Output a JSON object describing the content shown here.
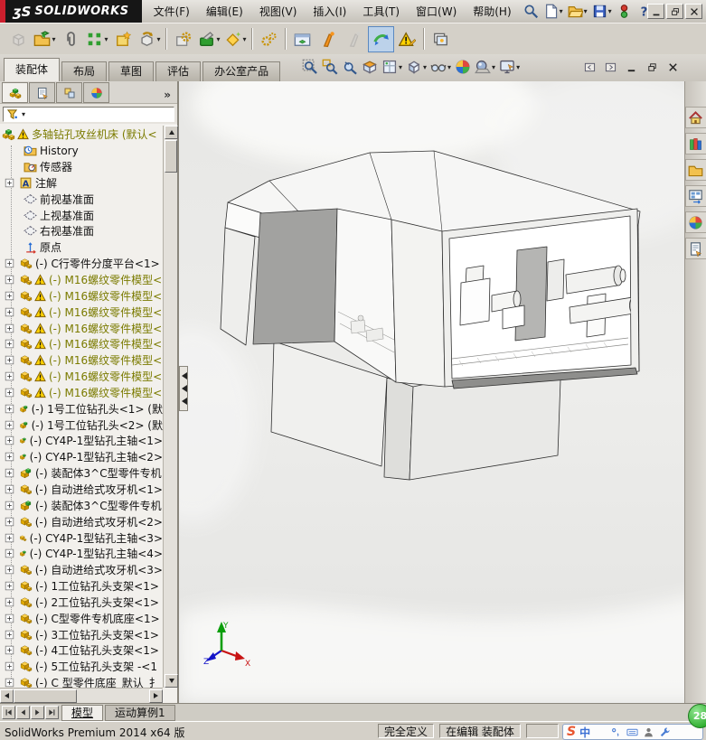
{
  "titlebar": {
    "logo_mark": "ʒS",
    "logo_text": "SOLIDWORKS",
    "menus": [
      "文件(F)",
      "编辑(E)",
      "视图(V)",
      "插入(I)",
      "工具(T)",
      "窗口(W)",
      "帮助(H)"
    ],
    "quick_buttons": [
      {
        "name": "search-button",
        "glyph": "search"
      },
      {
        "name": "new-document-button",
        "glyph": "newdoc",
        "dropdown": true
      },
      {
        "name": "open-button",
        "glyph": "open",
        "dropdown": true
      },
      {
        "name": "save-button",
        "glyph": "save",
        "dropdown": true
      },
      {
        "name": "traffic-light-button",
        "glyph": "traffic"
      },
      {
        "name": "help-button",
        "glyph": "help",
        "dropdown": true
      }
    ],
    "window_buttons": [
      {
        "name": "minimize-button",
        "glyph": "wmin"
      },
      {
        "name": "restore-button",
        "glyph": "wrest"
      },
      {
        "name": "close-button",
        "glyph": "wclose"
      }
    ]
  },
  "toolbar": {
    "buttons": [
      {
        "name": "edit-component-button",
        "glyph": "cubegray",
        "disabled": true
      },
      {
        "name": "insert-components-button",
        "glyph": "openpart",
        "dropdown": true
      },
      {
        "name": "mate-button",
        "glyph": "paperclip"
      },
      {
        "name": "linear-component-pattern-button",
        "glyph": "pattern",
        "dropdown": true
      },
      {
        "name": "smart-fasteners-button",
        "glyph": "smartfast"
      },
      {
        "name": "move-component-button",
        "glyph": "movecomp",
        "dropdown": true
      },
      {
        "sep": true
      },
      {
        "name": "assembly-features-button",
        "glyph": "gearbox"
      },
      {
        "name": "new-motion-study-button",
        "glyph": "hammergreen",
        "dropdown": true
      },
      {
        "name": "reference-geometry-button",
        "glyph": "diamondstar",
        "dropdown": true
      },
      {
        "sep": true
      },
      {
        "name": "assembly-settings-button",
        "glyph": "gears2"
      },
      {
        "sep": true
      },
      {
        "name": "show-hidden-components-button",
        "glyph": "winpart"
      },
      {
        "name": "exploded-view-button",
        "glyph": "explode"
      },
      {
        "name": "explode-line-sketch-button",
        "glyph": "explodegray",
        "disabled": true
      },
      {
        "name": "large-design-review-button",
        "glyph": "bluearrow",
        "pressed": true
      },
      {
        "name": "interference-detection-button",
        "glyph": "warnpencil"
      },
      {
        "sep": true
      },
      {
        "name": "take-snapshot-button",
        "glyph": "photos"
      }
    ]
  },
  "command_tabs": {
    "tabs": [
      {
        "label": "装配体",
        "active": true
      },
      {
        "label": "布局",
        "active": false
      },
      {
        "label": "草图",
        "active": false
      },
      {
        "label": "评估",
        "active": false
      },
      {
        "label": "办公室产品",
        "active": false
      }
    ]
  },
  "headsup": {
    "buttons": [
      {
        "name": "zoom-to-fit-button",
        "glyph": "zoomfit"
      },
      {
        "name": "zoom-to-area-button",
        "glyph": "zoomarea"
      },
      {
        "name": "magnified-selection-button",
        "glyph": "magsel"
      },
      {
        "name": "section-view-button",
        "glyph": "section"
      },
      {
        "name": "view-orientation-button",
        "glyph": "viewsheet",
        "dropdown": true
      },
      {
        "name": "display-style-button",
        "glyph": "viewcube",
        "dropdown": true
      },
      {
        "name": "hide-show-items-button",
        "glyph": "glasses",
        "dropdown": true
      },
      {
        "name": "edit-appearance-button",
        "glyph": "sphere4"
      },
      {
        "name": "apply-scene-button",
        "glyph": "scenesphere",
        "dropdown": true
      },
      {
        "name": "view-settings-button",
        "glyph": "monitor",
        "dropdown": true
      }
    ]
  },
  "doc_controls": [
    {
      "name": "doc-prev-window-button",
      "glyph": "docprev"
    },
    {
      "name": "doc-next-window-button",
      "glyph": "docnext"
    },
    {
      "name": "doc-minimize-button",
      "glyph": "wmin"
    },
    {
      "name": "doc-restore-button",
      "glyph": "wrest"
    },
    {
      "name": "doc-close-button",
      "glyph": "wclose"
    }
  ],
  "feature_panel": {
    "tabs": [
      {
        "name": "featuremanager-tab",
        "glyph": "asm",
        "active": true
      },
      {
        "name": "propertymanager-tab",
        "glyph": "propsheet",
        "active": false
      },
      {
        "name": "configurationmanager-tab",
        "glyph": "config",
        "active": false
      },
      {
        "name": "displaymanager-tab",
        "glyph": "sphere4",
        "active": false
      }
    ],
    "overflow_chevron": "»",
    "tree": {
      "items": [
        {
          "label": "多轴钻孔攻丝机床  (默认<",
          "icon": "asm",
          "warn": true,
          "olive": true,
          "root": true
        },
        {
          "label": "History",
          "icon": "history",
          "l1": true
        },
        {
          "label": "传感器",
          "icon": "sensors",
          "l1": true
        },
        {
          "label": "注解",
          "icon": "annot",
          "plus": true
        },
        {
          "label": "前视基准面",
          "icon": "plane",
          "l1": true
        },
        {
          "label": "上视基准面",
          "icon": "plane",
          "l1": true
        },
        {
          "label": "右视基准面",
          "icon": "plane",
          "l1": true
        },
        {
          "label": "原点",
          "icon": "origin",
          "l1": true
        },
        {
          "label": "(-) C行零件分度平台<1>",
          "icon": "part",
          "plus": true
        },
        {
          "label": "(-) M16螺纹零件模型<",
          "icon": "part",
          "plus": true,
          "warn": true,
          "olive": true
        },
        {
          "label": "(-) M16螺纹零件模型<",
          "icon": "part",
          "plus": true,
          "warn": true,
          "olive": true
        },
        {
          "label": "(-) M16螺纹零件模型<",
          "icon": "part",
          "plus": true,
          "warn": true,
          "olive": true
        },
        {
          "label": "(-) M16螺纹零件模型<",
          "icon": "part",
          "plus": true,
          "warn": true,
          "olive": true
        },
        {
          "label": "(-) M16螺纹零件模型<",
          "icon": "part",
          "plus": true,
          "warn": true,
          "olive": true
        },
        {
          "label": "(-) M16螺纹零件模型<",
          "icon": "part",
          "plus": true,
          "warn": true,
          "olive": true
        },
        {
          "label": "(-) M16螺纹零件模型<",
          "icon": "part",
          "plus": true,
          "warn": true,
          "olive": true
        },
        {
          "label": "(-) M16螺纹零件模型<",
          "icon": "part",
          "plus": true,
          "warn": true,
          "olive": true
        },
        {
          "label": "(-) 1号工位钻孔头<1> (默",
          "icon": "subasm",
          "plus": true
        },
        {
          "label": "(-) 1号工位钻孔头<2> (默",
          "icon": "subasm",
          "plus": true
        },
        {
          "label": "(-) CY4P-1型钻孔主轴<1>",
          "icon": "subasm",
          "plus": true
        },
        {
          "label": "(-) CY4P-1型钻孔主轴<2>",
          "icon": "subasm",
          "plus": true
        },
        {
          "label": "(-) 装配体3^C型零件专机",
          "icon": "subasm",
          "plus": true
        },
        {
          "label": "(-) 自动进给式攻牙机<1>",
          "icon": "part",
          "plus": true
        },
        {
          "label": "(-) 装配体3^C型零件专机",
          "icon": "subasm",
          "plus": true
        },
        {
          "label": "(-) 自动进给式攻牙机<2>",
          "icon": "part",
          "plus": true
        },
        {
          "label": "(-) CY4P-1型钻孔主轴<3>",
          "icon": "part",
          "plus": true
        },
        {
          "label": "(-) CY4P-1型钻孔主轴<4>",
          "icon": "subasm",
          "plus": true
        },
        {
          "label": "(-) 自动进给式攻牙机<3>",
          "icon": "part",
          "plus": true
        },
        {
          "label": "(-) 1工位钻孔头支架<1>",
          "icon": "part",
          "plus": true
        },
        {
          "label": "(-) 2工位钻孔头支架<1>",
          "icon": "part",
          "plus": true
        },
        {
          "label": "(-) C型零件专机底座<1>",
          "icon": "part",
          "plus": true
        },
        {
          "label": "(-) 3工位钻孔头支架<1>",
          "icon": "part",
          "plus": true
        },
        {
          "label": "(-) 4工位钻孔头支架<1>",
          "icon": "part",
          "plus": true
        },
        {
          "label": "(-) 5工位钻孔头支架 -<1",
          "icon": "part",
          "plus": true
        },
        {
          "label": "(-) C 型零件底座_默认_扌",
          "icon": "part",
          "plus": true
        }
      ]
    }
  },
  "task_pane": {
    "tabs": [
      {
        "name": "solidworks-resources-tab",
        "glyph": "home"
      },
      {
        "name": "design-library-tab",
        "glyph": "library"
      },
      {
        "name": "file-explorer-tab",
        "glyph": "folderx"
      },
      {
        "name": "view-palette-tab",
        "glyph": "palette"
      },
      {
        "name": "appearances-scenes-tab",
        "glyph": "sphere4"
      },
      {
        "name": "custom-properties-tab",
        "glyph": "props"
      }
    ]
  },
  "motion_bar": {
    "nav": [
      {
        "name": "first-tab-button",
        "glyph": "navfirst"
      },
      {
        "name": "prev-tab-button",
        "glyph": "navprev"
      },
      {
        "name": "next-tab-button",
        "glyph": "navnext"
      },
      {
        "name": "last-tab-button",
        "glyph": "navlast"
      }
    ],
    "tabs": [
      {
        "label": "模型",
        "active": true
      },
      {
        "label": "运动算例1",
        "active": false
      }
    ]
  },
  "status_bar": {
    "app_version": "SolidWorks Premium 2014 x64 版",
    "define_state": "完全定义",
    "edit_state": "在编辑  装配体"
  },
  "ime_bar": {
    "logo": "S",
    "lang": "中",
    "icons": [
      {
        "name": "ime-mode-icon",
        "glyph": "moon"
      },
      {
        "name": "ime-punctuation-icon",
        "glyph": "punct"
      },
      {
        "name": "ime-keyboard-icon",
        "glyph": "keyboard"
      },
      {
        "name": "ime-account-icon",
        "glyph": "person"
      },
      {
        "name": "ime-tools-icon",
        "glyph": "wrench"
      }
    ]
  },
  "notification_badge": "28",
  "triad": {
    "x": "X",
    "y": "Y",
    "z": "Z"
  },
  "colors": {
    "titlebar_red": "#cc1f2d",
    "tree_warning_text": "#7b7b00",
    "badge_green": "#2fae2f",
    "pressed_button_blue": "#bcd2ea"
  }
}
